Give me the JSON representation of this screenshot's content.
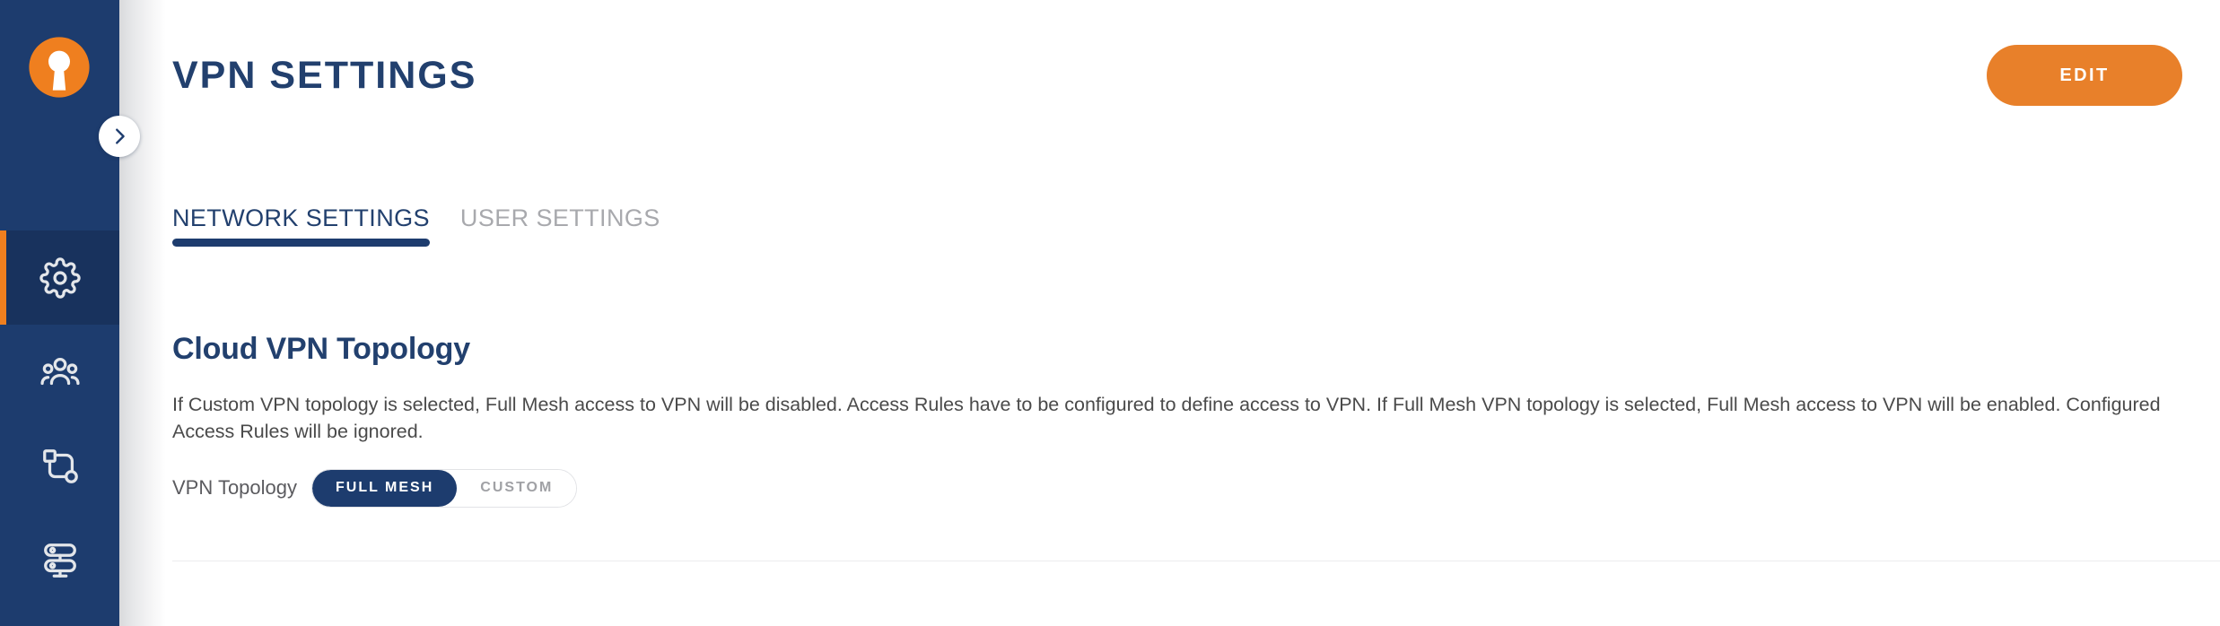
{
  "sidebar": {
    "logo_name": "openvpn-logo",
    "expand_button": {
      "icon": "chevron-right-icon"
    },
    "items": [
      {
        "icon": "gear-icon",
        "name": "settings",
        "active": true
      },
      {
        "icon": "users-icon",
        "name": "users",
        "active": false
      },
      {
        "icon": "network-topology-icon",
        "name": "network",
        "active": false
      },
      {
        "icon": "servers-icon",
        "name": "servers",
        "active": false
      }
    ]
  },
  "header": {
    "title": "VPN SETTINGS",
    "edit_label": "EDIT"
  },
  "tabs": [
    {
      "label": "NETWORK SETTINGS",
      "active": true
    },
    {
      "label": "USER SETTINGS",
      "active": false
    }
  ],
  "section": {
    "title": "Cloud VPN Topology",
    "description": "If Custom VPN topology is selected, Full Mesh access to VPN will be disabled. Access Rules have to be configured to define access to VPN. If Full Mesh VPN topology is selected, Full Mesh access to VPN will be enabled. Configured Access Rules will be ignored.",
    "field_label": "VPN Topology",
    "options": [
      {
        "label": "FULL MESH",
        "selected": true
      },
      {
        "label": "CUSTOM",
        "selected": false
      }
    ]
  },
  "colors": {
    "navy": "#1d3c6e",
    "navy_dark": "#18325d",
    "orange": "#e8802a",
    "orange_accent": "#ef7f1f",
    "title_navy": "#22406e",
    "muted_gray": "#a8a9ad"
  }
}
